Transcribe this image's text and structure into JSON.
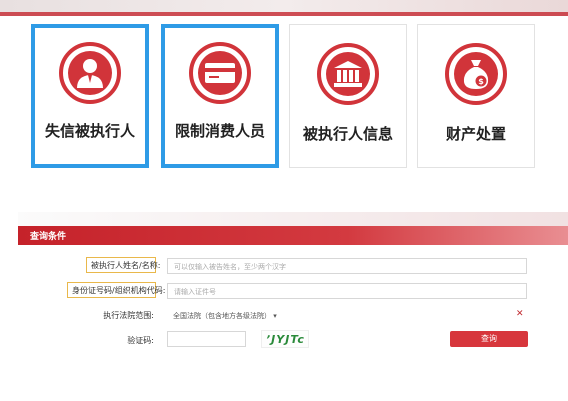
{
  "cards": [
    {
      "label": "失信被执行人",
      "icon": "person-icon",
      "selected": true
    },
    {
      "label": "限制消费人员",
      "icon": "credit-card-icon",
      "selected": true
    },
    {
      "label": "被执行人信息",
      "icon": "courthouse-icon",
      "selected": false
    },
    {
      "label": "财产处置",
      "icon": "money-bag-icon",
      "selected": false
    }
  ],
  "panel": {
    "title": "查询条件"
  },
  "form": {
    "name_label": "被执行人姓名/名称:",
    "name_placeholder": "可以仅输入被告姓名，至少两个汉字",
    "id_label": "身份证号码/组织机构代码:",
    "id_placeholder": "请输入证件号",
    "court_label": "执行法院范围:",
    "court_value": "全国法院（包含地方各级法院）",
    "captcha_label": "验证码:",
    "captcha_text": "ʼJYJTc",
    "query_button": "查询"
  },
  "colors": {
    "accent": "#d1343a",
    "selected_border": "#2e9be6"
  }
}
